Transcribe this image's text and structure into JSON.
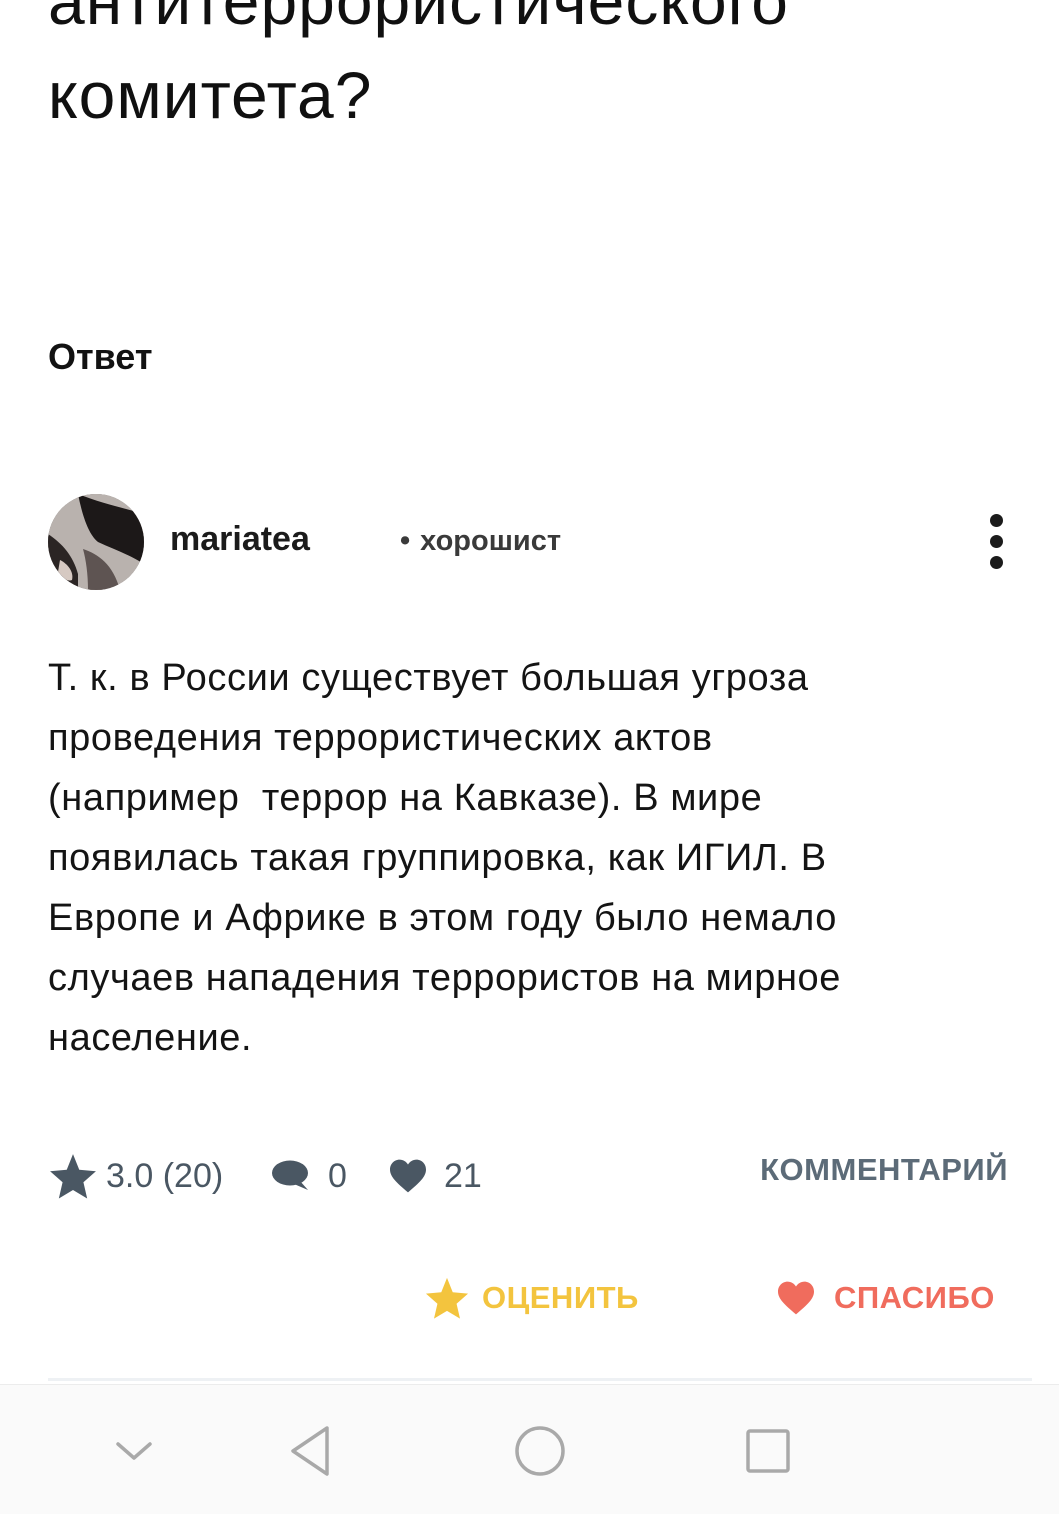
{
  "question": {
    "title_lines": [
      "антитеррористического",
      "комитета?"
    ]
  },
  "answer_heading": "Ответ",
  "author": {
    "name": "mariatea",
    "rank_separator": "•",
    "rank": "хорошист"
  },
  "answer": {
    "lines": [
      "Т. к. в России существует большая угроза",
      "проведения террористических актов",
      "(например  террор на Кавказе). В мире",
      "появилась такая группировка, как ИГИЛ. В",
      "Европе и Африке в этом году было немало",
      "случаев нападения террористов на мирное",
      "население."
    ]
  },
  "stats": {
    "rating": "3.0 (20)",
    "comments": "0",
    "likes": "21",
    "comment_link": "КОММЕНТАРИЙ"
  },
  "actions": {
    "rate_label": "ОЦЕНИТЬ",
    "thanks_label": "СПАСИБО"
  },
  "colors": {
    "rate_accent": "#f3c43e",
    "thanks_accent": "#f06c5d",
    "stat_gray": "#4a5763"
  },
  "icons": {
    "rating": "star-icon",
    "comments": "comment-bubble-icon",
    "likes": "heart-icon",
    "rate": "star-icon",
    "thanks": "heart-icon",
    "more": "more-vertical-icon",
    "nav": [
      "chevron-down-icon",
      "back-triangle-icon",
      "home-circle-icon",
      "recent-square-icon"
    ]
  }
}
